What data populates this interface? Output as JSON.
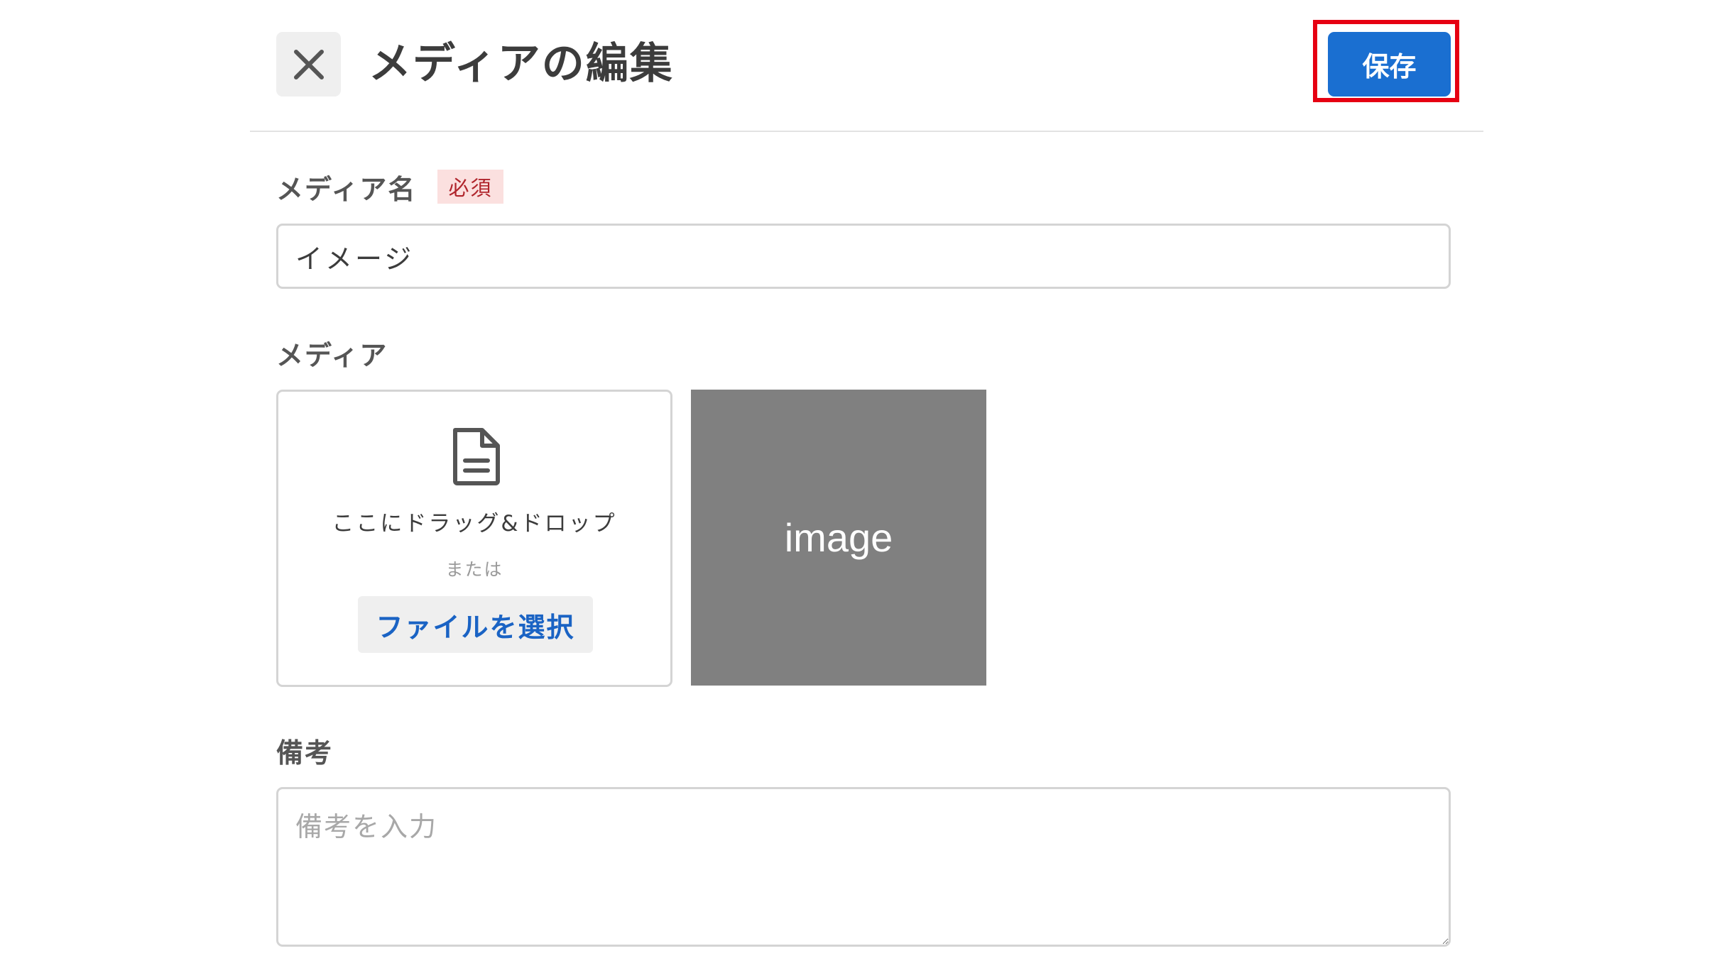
{
  "header": {
    "close_icon": "close-icon",
    "title": "メディアの編集",
    "save_label": "保存",
    "highlight_color": "#e60012",
    "save_color": "#1a6fd1"
  },
  "form": {
    "media_name": {
      "label": "メディア名",
      "required_badge": "必須",
      "value": "イメージ"
    },
    "media": {
      "label": "メディア",
      "dropzone": {
        "icon": "file-document-icon",
        "drop_text": "ここにドラッグ&ドロップ",
        "or_text": "または",
        "select_button": "ファイルを選択"
      },
      "preview_text": "image"
    },
    "note": {
      "label": "備考",
      "placeholder": "備考を入力",
      "value": ""
    }
  }
}
